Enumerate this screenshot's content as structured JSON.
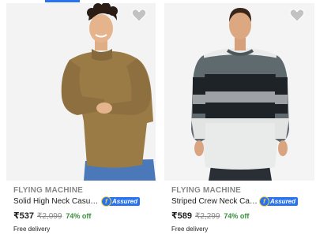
{
  "products": [
    {
      "brand": "FLYING MACHINE",
      "title": "Solid High Neck Casual ...",
      "assured_label": "Assured",
      "price": "₹537",
      "mrp": "₹2,099",
      "discount": "74% off",
      "delivery": "Free delivery",
      "image": "model wearing olive high neck sweater"
    },
    {
      "brand": "FLYING MACHINE",
      "title": "Striped Crew Neck Casu...",
      "assured_label": "Assured",
      "price": "₹589",
      "mrp": "₹2,299",
      "discount": "74% off",
      "delivery": "Free delivery",
      "image": "model wearing striped crew neck sweater"
    }
  ],
  "colors": {
    "accent": "#2874f0",
    "discount": "#388e3c",
    "brand_text": "#878787"
  }
}
